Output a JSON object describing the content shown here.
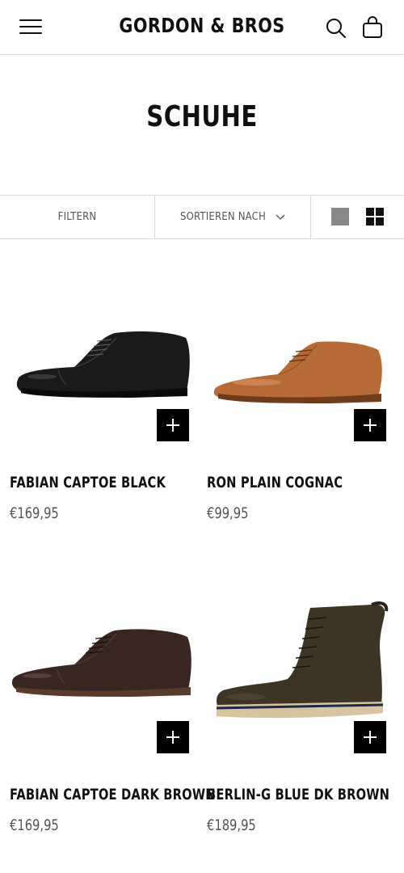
{
  "header": {
    "brand": "GORDON & BROS",
    "icons": [
      "menu-icon",
      "search-icon",
      "shopping-bag-icon"
    ]
  },
  "page": {
    "title": "SCHUHE"
  },
  "toolbar": {
    "filter_label": "FILTERN",
    "sort_label": "SORTIEREN NACH",
    "view_options": [
      "single-column-view-icon",
      "grid-view-icon"
    ],
    "active_view": "grid"
  },
  "products": [
    {
      "name": "FABIAN CAPTOE BLACK",
      "price": "€169,95",
      "shoe_color": "#1a1a1a"
    },
    {
      "name": "RON PLAIN COGNAC",
      "price": "€99,95",
      "shoe_color": "#b86a35"
    },
    {
      "name": "FABIAN CAPTOE DARK BROWN",
      "price": "€169,95",
      "shoe_color": "#3a2520"
    },
    {
      "name": "BERLIN-G BLUE DK BROWN",
      "price": "€189,95",
      "shoe_color": "#3d3424"
    }
  ],
  "colors": {
    "text": "#111111",
    "price": "#555555",
    "border": "#d9d9d9",
    "button": "#000000"
  }
}
